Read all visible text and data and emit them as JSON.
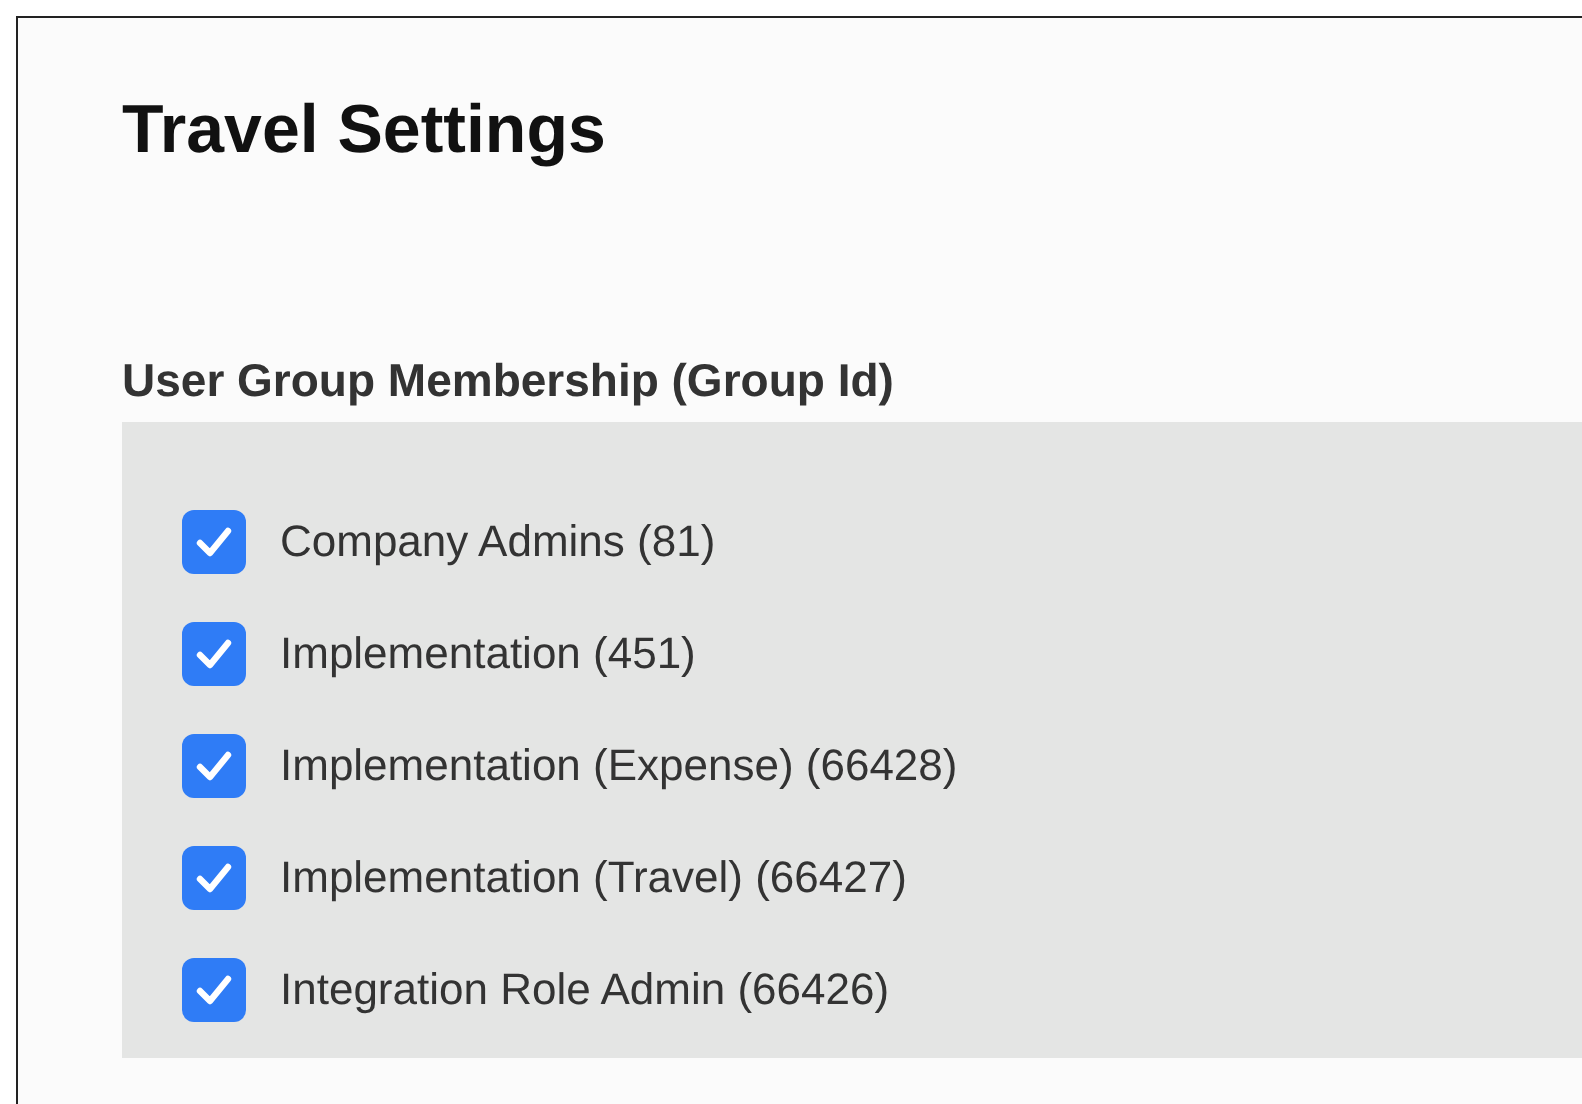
{
  "title": "Travel Settings",
  "section": {
    "heading": "User Group Membership (Group Id)",
    "groups": [
      {
        "label": "Company Admins (81)",
        "checked": true
      },
      {
        "label": "Implementation (451)",
        "checked": true
      },
      {
        "label": "Implementation (Expense) (66428)",
        "checked": true
      },
      {
        "label": "Implementation (Travel) (66427)",
        "checked": true
      },
      {
        "label": "Integration Role Admin (66426)",
        "checked": true
      }
    ]
  }
}
